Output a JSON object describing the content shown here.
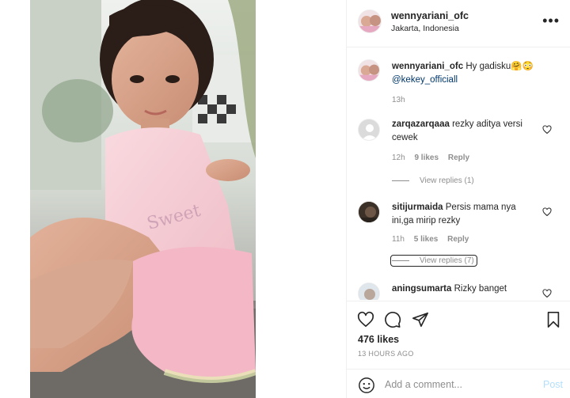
{
  "header": {
    "username": "wennyariani_ofc",
    "location": "Jakarta, Indonesia",
    "more_icon": "more-horizontal-icon"
  },
  "caption": {
    "username": "wennyariani_ofc",
    "text": "Hy gadisku🤗😳",
    "mention": "@kekey_officiall",
    "time": "13h"
  },
  "comments": [
    {
      "username": "zarqazarqaaa",
      "text": "rezky aditya versi cewek",
      "time": "12h",
      "likes": "9 likes",
      "reply_label": "Reply",
      "view_replies": "View replies (1)"
    },
    {
      "username": "sitijurmaida",
      "text": "Persis mama nya ini,ga mirip rezky",
      "time": "11h",
      "likes": "5 likes",
      "reply_label": "Reply",
      "view_replies": "View replies (7)"
    },
    {
      "username": "aningsumarta",
      "text": "Rizky banget"
    }
  ],
  "actions": {
    "like_icon": "heart-icon",
    "comment_icon": "comment-icon",
    "share_icon": "paper-plane-icon",
    "save_icon": "bookmark-icon",
    "likes": "476 likes",
    "time_ago": "13 HOURS AGO"
  },
  "add_comment": {
    "placeholder": "Add a comment...",
    "post_label": "Post",
    "emoji_icon": "smiley-icon"
  },
  "colors": {
    "link": "#00376b",
    "muted": "#8e8e8e",
    "post_disabled": "#b2dffc",
    "border": "#efefef"
  }
}
